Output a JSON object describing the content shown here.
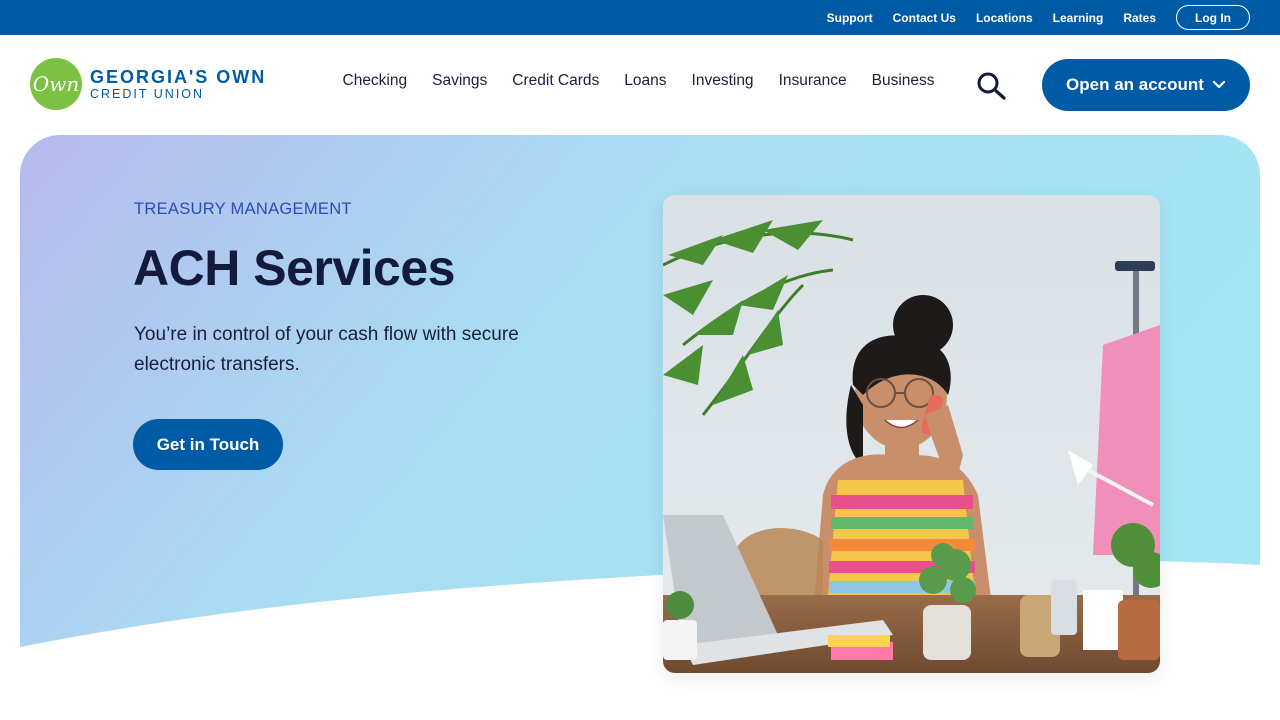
{
  "utility_nav": {
    "links": [
      "Support",
      "Contact Us",
      "Locations",
      "Learning",
      "Rates"
    ],
    "login_label": "Log In"
  },
  "brand": {
    "logo_mark": "Own",
    "name_line1": "GEORGIA'S OWN",
    "name_line2": "CREDIT UNION",
    "primary_color": "#005ba6",
    "logo_green": "#7cc242"
  },
  "main_nav": {
    "items": [
      "Checking",
      "Savings",
      "Credit Cards",
      "Loans",
      "Investing",
      "Insurance",
      "Business"
    ],
    "search_icon": "search-icon",
    "open_account_label": "Open an account"
  },
  "hero": {
    "eyebrow": "TREASURY MANAGEMENT",
    "title": "ACH Services",
    "subtitle": "You’re in control of your cash flow with secure electronic transfers.",
    "cta_label": "Get in Touch"
  }
}
